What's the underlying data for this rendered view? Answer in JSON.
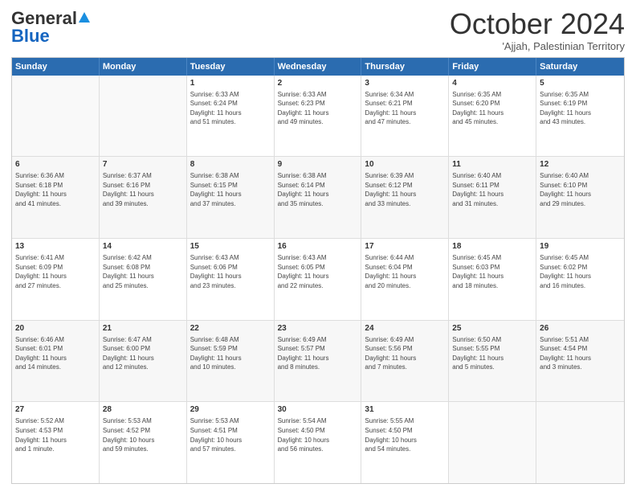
{
  "logo": {
    "general": "General",
    "blue": "Blue"
  },
  "header": {
    "month": "October 2024",
    "location": "'Ajjah, Palestinian Territory"
  },
  "days": [
    "Sunday",
    "Monday",
    "Tuesday",
    "Wednesday",
    "Thursday",
    "Friday",
    "Saturday"
  ],
  "weeks": [
    [
      {
        "day": "",
        "lines": []
      },
      {
        "day": "",
        "lines": []
      },
      {
        "day": "1",
        "lines": [
          "Sunrise: 6:33 AM",
          "Sunset: 6:24 PM",
          "Daylight: 11 hours",
          "and 51 minutes."
        ]
      },
      {
        "day": "2",
        "lines": [
          "Sunrise: 6:33 AM",
          "Sunset: 6:23 PM",
          "Daylight: 11 hours",
          "and 49 minutes."
        ]
      },
      {
        "day": "3",
        "lines": [
          "Sunrise: 6:34 AM",
          "Sunset: 6:21 PM",
          "Daylight: 11 hours",
          "and 47 minutes."
        ]
      },
      {
        "day": "4",
        "lines": [
          "Sunrise: 6:35 AM",
          "Sunset: 6:20 PM",
          "Daylight: 11 hours",
          "and 45 minutes."
        ]
      },
      {
        "day": "5",
        "lines": [
          "Sunrise: 6:35 AM",
          "Sunset: 6:19 PM",
          "Daylight: 11 hours",
          "and 43 minutes."
        ]
      }
    ],
    [
      {
        "day": "6",
        "lines": [
          "Sunrise: 6:36 AM",
          "Sunset: 6:18 PM",
          "Daylight: 11 hours",
          "and 41 minutes."
        ]
      },
      {
        "day": "7",
        "lines": [
          "Sunrise: 6:37 AM",
          "Sunset: 6:16 PM",
          "Daylight: 11 hours",
          "and 39 minutes."
        ]
      },
      {
        "day": "8",
        "lines": [
          "Sunrise: 6:38 AM",
          "Sunset: 6:15 PM",
          "Daylight: 11 hours",
          "and 37 minutes."
        ]
      },
      {
        "day": "9",
        "lines": [
          "Sunrise: 6:38 AM",
          "Sunset: 6:14 PM",
          "Daylight: 11 hours",
          "and 35 minutes."
        ]
      },
      {
        "day": "10",
        "lines": [
          "Sunrise: 6:39 AM",
          "Sunset: 6:12 PM",
          "Daylight: 11 hours",
          "and 33 minutes."
        ]
      },
      {
        "day": "11",
        "lines": [
          "Sunrise: 6:40 AM",
          "Sunset: 6:11 PM",
          "Daylight: 11 hours",
          "and 31 minutes."
        ]
      },
      {
        "day": "12",
        "lines": [
          "Sunrise: 6:40 AM",
          "Sunset: 6:10 PM",
          "Daylight: 11 hours",
          "and 29 minutes."
        ]
      }
    ],
    [
      {
        "day": "13",
        "lines": [
          "Sunrise: 6:41 AM",
          "Sunset: 6:09 PM",
          "Daylight: 11 hours",
          "and 27 minutes."
        ]
      },
      {
        "day": "14",
        "lines": [
          "Sunrise: 6:42 AM",
          "Sunset: 6:08 PM",
          "Daylight: 11 hours",
          "and 25 minutes."
        ]
      },
      {
        "day": "15",
        "lines": [
          "Sunrise: 6:43 AM",
          "Sunset: 6:06 PM",
          "Daylight: 11 hours",
          "and 23 minutes."
        ]
      },
      {
        "day": "16",
        "lines": [
          "Sunrise: 6:43 AM",
          "Sunset: 6:05 PM",
          "Daylight: 11 hours",
          "and 22 minutes."
        ]
      },
      {
        "day": "17",
        "lines": [
          "Sunrise: 6:44 AM",
          "Sunset: 6:04 PM",
          "Daylight: 11 hours",
          "and 20 minutes."
        ]
      },
      {
        "day": "18",
        "lines": [
          "Sunrise: 6:45 AM",
          "Sunset: 6:03 PM",
          "Daylight: 11 hours",
          "and 18 minutes."
        ]
      },
      {
        "day": "19",
        "lines": [
          "Sunrise: 6:45 AM",
          "Sunset: 6:02 PM",
          "Daylight: 11 hours",
          "and 16 minutes."
        ]
      }
    ],
    [
      {
        "day": "20",
        "lines": [
          "Sunrise: 6:46 AM",
          "Sunset: 6:01 PM",
          "Daylight: 11 hours",
          "and 14 minutes."
        ]
      },
      {
        "day": "21",
        "lines": [
          "Sunrise: 6:47 AM",
          "Sunset: 6:00 PM",
          "Daylight: 11 hours",
          "and 12 minutes."
        ]
      },
      {
        "day": "22",
        "lines": [
          "Sunrise: 6:48 AM",
          "Sunset: 5:59 PM",
          "Daylight: 11 hours",
          "and 10 minutes."
        ]
      },
      {
        "day": "23",
        "lines": [
          "Sunrise: 6:49 AM",
          "Sunset: 5:57 PM",
          "Daylight: 11 hours",
          "and 8 minutes."
        ]
      },
      {
        "day": "24",
        "lines": [
          "Sunrise: 6:49 AM",
          "Sunset: 5:56 PM",
          "Daylight: 11 hours",
          "and 7 minutes."
        ]
      },
      {
        "day": "25",
        "lines": [
          "Sunrise: 6:50 AM",
          "Sunset: 5:55 PM",
          "Daylight: 11 hours",
          "and 5 minutes."
        ]
      },
      {
        "day": "26",
        "lines": [
          "Sunrise: 5:51 AM",
          "Sunset: 4:54 PM",
          "Daylight: 11 hours",
          "and 3 minutes."
        ]
      }
    ],
    [
      {
        "day": "27",
        "lines": [
          "Sunrise: 5:52 AM",
          "Sunset: 4:53 PM",
          "Daylight: 11 hours",
          "and 1 minute."
        ]
      },
      {
        "day": "28",
        "lines": [
          "Sunrise: 5:53 AM",
          "Sunset: 4:52 PM",
          "Daylight: 10 hours",
          "and 59 minutes."
        ]
      },
      {
        "day": "29",
        "lines": [
          "Sunrise: 5:53 AM",
          "Sunset: 4:51 PM",
          "Daylight: 10 hours",
          "and 57 minutes."
        ]
      },
      {
        "day": "30",
        "lines": [
          "Sunrise: 5:54 AM",
          "Sunset: 4:50 PM",
          "Daylight: 10 hours",
          "and 56 minutes."
        ]
      },
      {
        "day": "31",
        "lines": [
          "Sunrise: 5:55 AM",
          "Sunset: 4:50 PM",
          "Daylight: 10 hours",
          "and 54 minutes."
        ]
      },
      {
        "day": "",
        "lines": []
      },
      {
        "day": "",
        "lines": []
      }
    ]
  ]
}
